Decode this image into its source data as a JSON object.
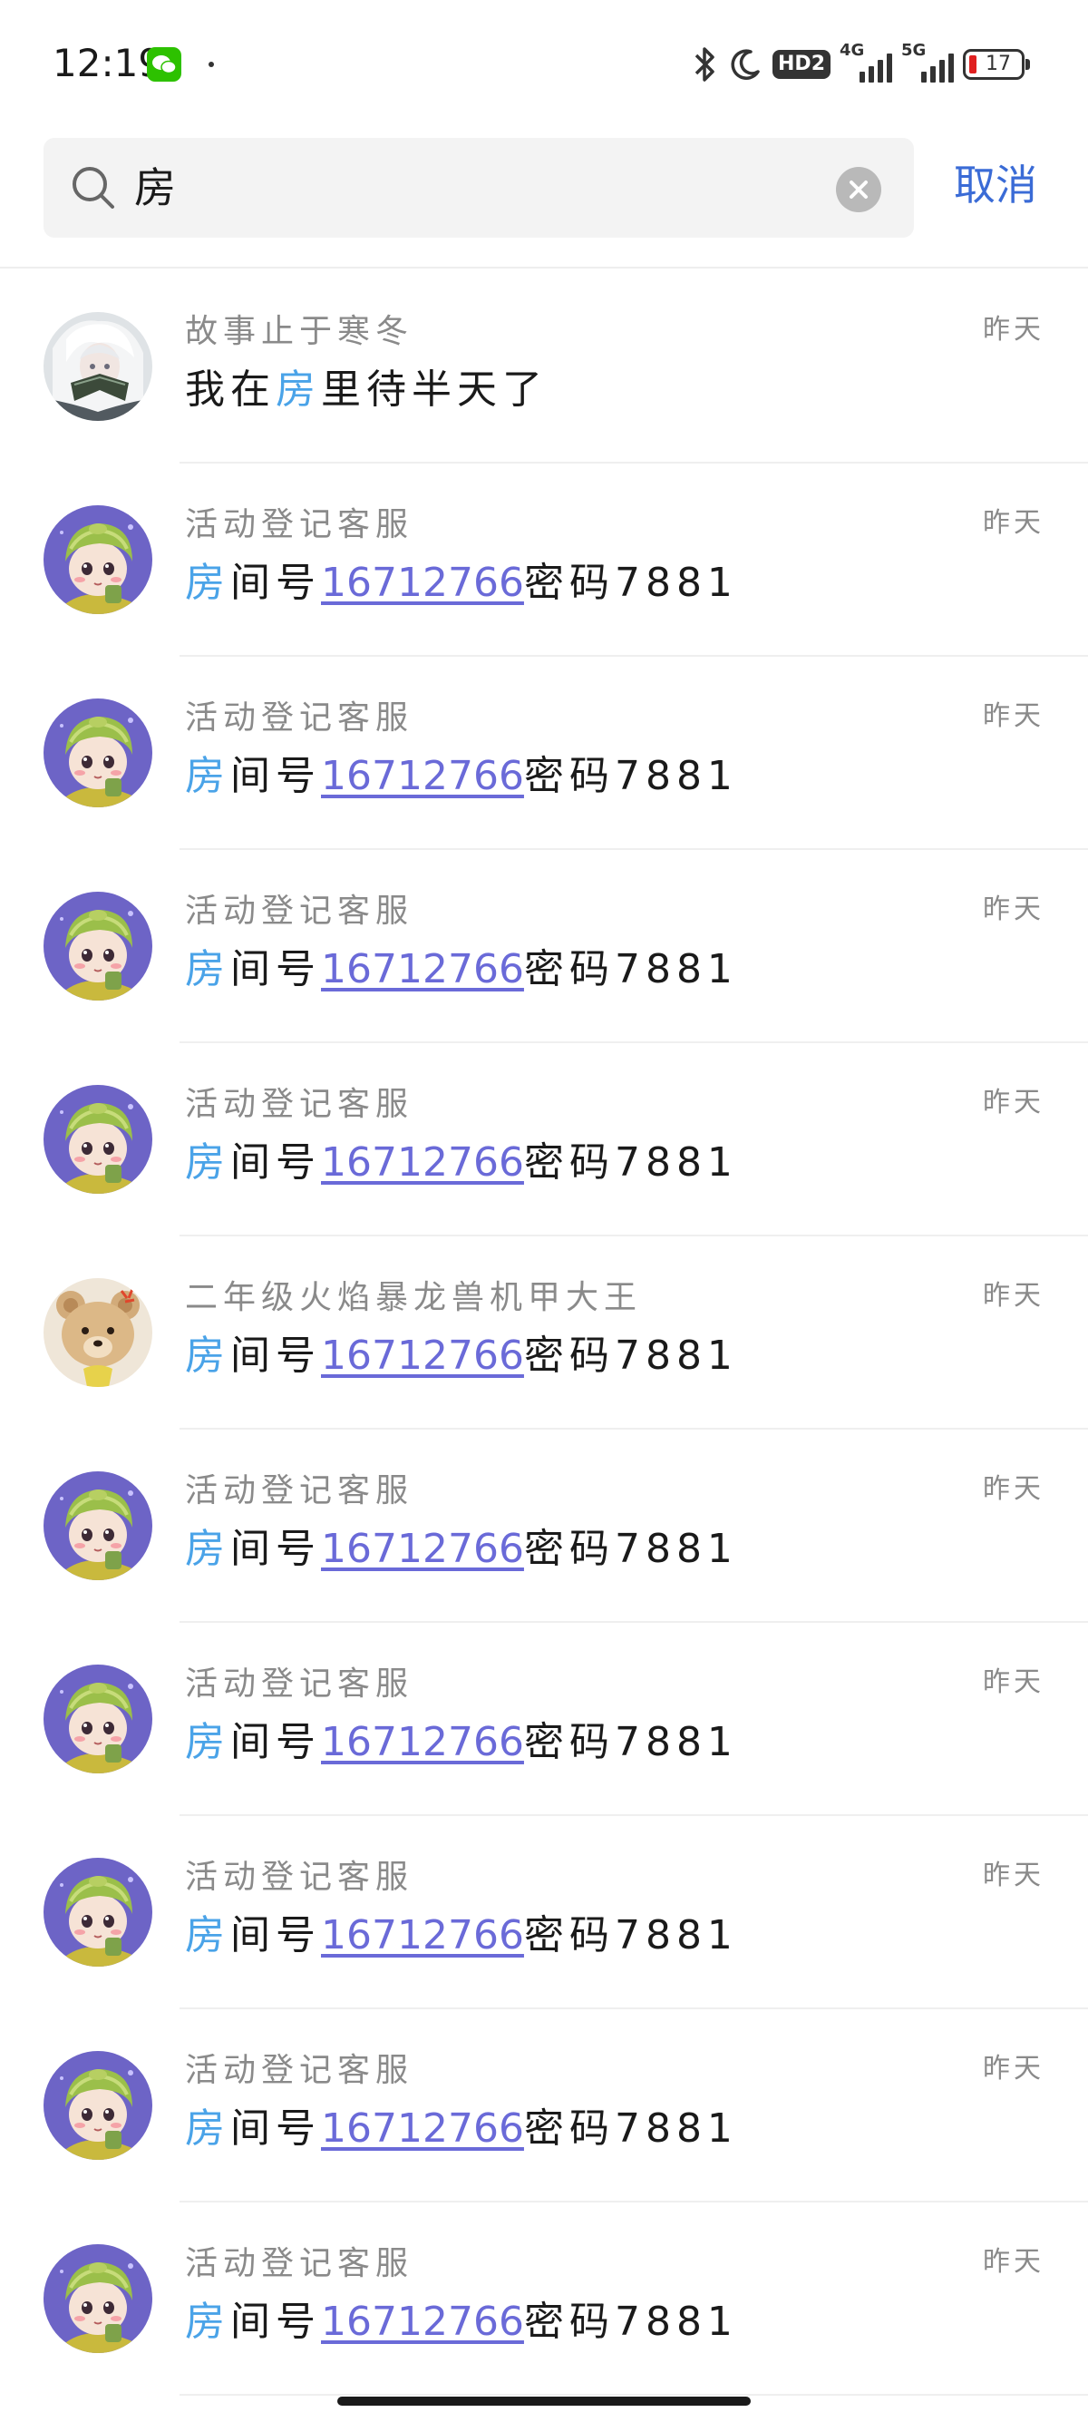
{
  "status_bar": {
    "time": "12:19",
    "hd_label": "HD2",
    "net1": "4G",
    "net2": "5G",
    "battery": "17",
    "battery_color": "#e02020"
  },
  "search": {
    "query": "房",
    "placeholder": "",
    "cancel_label": "取消",
    "accent": "#3a6bd6"
  },
  "results": [
    {
      "name": "故事止于寒冬",
      "time": "昨天",
      "avatar": "girl-fan",
      "pre": "我在",
      "hl": "房",
      "post": "里待半天了",
      "number": "",
      "after": ""
    },
    {
      "name": "活动登记客服",
      "time": "昨天",
      "avatar": "green-hat",
      "pre": "",
      "hl": "房",
      "post": "间号",
      "number": "16712766",
      "after": "密码7881"
    },
    {
      "name": "活动登记客服",
      "time": "昨天",
      "avatar": "green-hat",
      "pre": "",
      "hl": "房",
      "post": "间号",
      "number": "16712766",
      "after": "密码7881"
    },
    {
      "name": "活动登记客服",
      "time": "昨天",
      "avatar": "green-hat",
      "pre": "",
      "hl": "房",
      "post": "间号",
      "number": "16712766",
      "after": "密码7881"
    },
    {
      "name": "活动登记客服",
      "time": "昨天",
      "avatar": "green-hat",
      "pre": "",
      "hl": "房",
      "post": "间号",
      "number": "16712766",
      "after": "密码7881"
    },
    {
      "name": "二年级火焰暴龙兽机甲大王",
      "time": "昨天",
      "avatar": "teddy-bear",
      "pre": "",
      "hl": "房",
      "post": "间号",
      "number": "16712766",
      "after": "密码7881"
    },
    {
      "name": "活动登记客服",
      "time": "昨天",
      "avatar": "green-hat",
      "pre": "",
      "hl": "房",
      "post": "间号",
      "number": "16712766",
      "after": "密码7881"
    },
    {
      "name": "活动登记客服",
      "time": "昨天",
      "avatar": "green-hat",
      "pre": "",
      "hl": "房",
      "post": "间号",
      "number": "16712766",
      "after": "密码7881"
    },
    {
      "name": "活动登记客服",
      "time": "昨天",
      "avatar": "green-hat",
      "pre": "",
      "hl": "房",
      "post": "间号",
      "number": "16712766",
      "after": "密码7881"
    },
    {
      "name": "活动登记客服",
      "time": "昨天",
      "avatar": "green-hat",
      "pre": "",
      "hl": "房",
      "post": "间号",
      "number": "16712766",
      "after": "密码7881"
    },
    {
      "name": "活动登记客服",
      "time": "昨天",
      "avatar": "green-hat",
      "pre": "",
      "hl": "房",
      "post": "间号",
      "number": "16712766",
      "after": "密码7881"
    }
  ]
}
